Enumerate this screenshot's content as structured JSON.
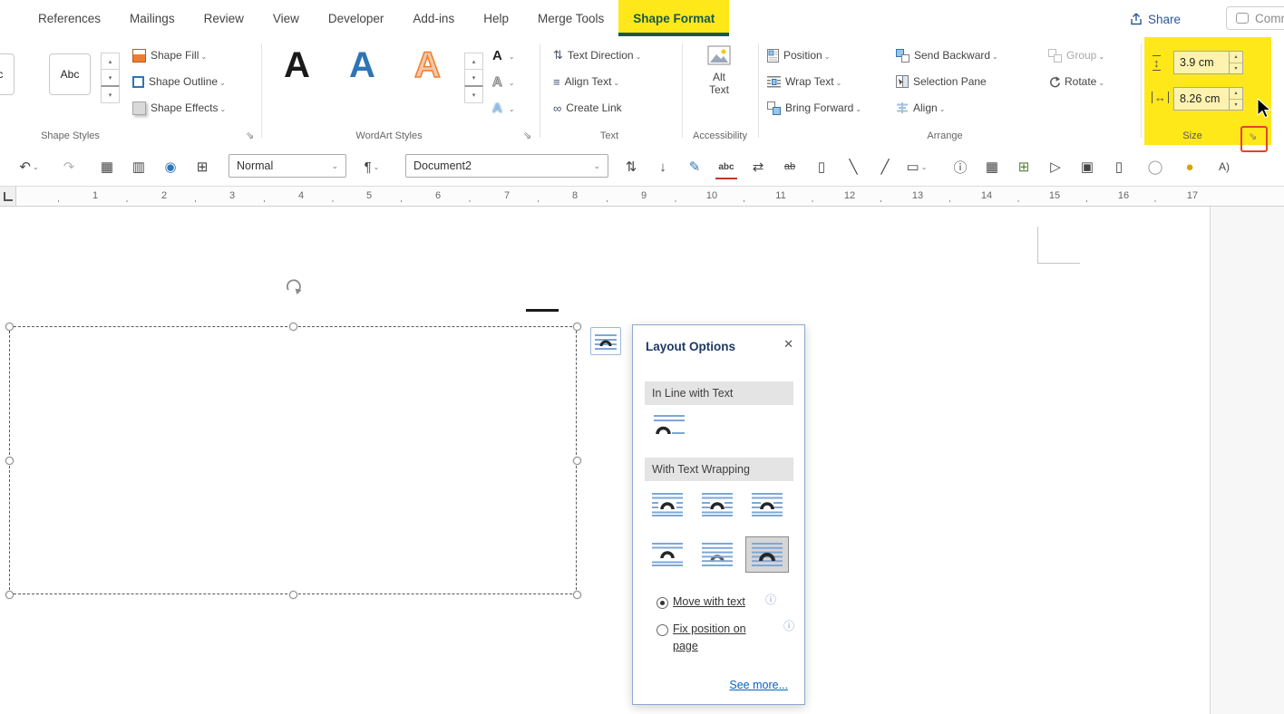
{
  "tabbar": {
    "tabs": [
      {
        "label": "References"
      },
      {
        "label": "Mailings"
      },
      {
        "label": "Review"
      },
      {
        "label": "View"
      },
      {
        "label": "Developer"
      },
      {
        "label": "Add-ins"
      },
      {
        "label": "Help"
      },
      {
        "label": "Merge Tools"
      },
      {
        "label": "Shape Format"
      }
    ],
    "share_label": "Share",
    "comments_label": "Comments"
  },
  "ribbon": {
    "shape_styles": {
      "label": "Shape Styles",
      "presets": [
        "Abc",
        "Abc"
      ],
      "fill_label": "Shape Fill",
      "outline_label": "Shape Outline",
      "effects_label": "Shape Effects"
    },
    "wordart": {
      "label": "WordArt Styles",
      "samples": [
        "A",
        "A",
        "A"
      ]
    },
    "text_group": {
      "label": "Text",
      "direction_label": "Text Direction",
      "align_label": "Align Text",
      "link_label": "Create Link"
    },
    "accessibility": {
      "label": "Accessibility",
      "alt_text_label": "Alt Text"
    },
    "arrange": {
      "label": "Arrange",
      "position_label": "Position",
      "wrap_label": "Wrap Text",
      "bring_forward_label": "Bring Forward",
      "send_backward_label": "Send Backward",
      "selection_pane_label": "Selection Pane",
      "align_label": "Align",
      "group_label": "Group",
      "rotate_label": "Rotate"
    },
    "size": {
      "label": "Size",
      "height_value": "3.9 cm",
      "width_value": "8.26 cm"
    }
  },
  "toolbar": {
    "style_value": "Normal",
    "document_value": "Document2",
    "icons": [
      {
        "name": "undo",
        "glyph": "↶"
      },
      {
        "name": "redo",
        "glyph": "↷"
      },
      {
        "name": "table-borders",
        "glyph": "▦"
      },
      {
        "name": "table-shading",
        "glyph": "▥"
      },
      {
        "name": "record-macro",
        "glyph": "◉"
      },
      {
        "name": "insert-table",
        "glyph": "⊞"
      },
      {
        "name": "pilcrow",
        "glyph": "¶"
      },
      {
        "name": "line-spacing",
        "glyph": "⇅"
      },
      {
        "name": "page-down",
        "glyph": "↓"
      },
      {
        "name": "edit-pen",
        "glyph": "✎"
      },
      {
        "name": "spell-check",
        "glyph": "abc"
      },
      {
        "name": "translate",
        "glyph": "⇄"
      },
      {
        "name": "strikethrough",
        "glyph": "ab"
      },
      {
        "name": "blank-page",
        "glyph": "▯"
      },
      {
        "name": "backslash",
        "glyph": "╲"
      },
      {
        "name": "slash",
        "glyph": "╱"
      },
      {
        "name": "text-frame",
        "glyph": "▭"
      },
      {
        "name": "doc-info",
        "glyph": "ⓘ"
      },
      {
        "name": "grid",
        "glyph": "▦"
      },
      {
        "name": "add-table",
        "glyph": "⊞"
      },
      {
        "name": "next-page",
        "glyph": "▷"
      },
      {
        "name": "print-layout",
        "glyph": "▣"
      },
      {
        "name": "page",
        "glyph": "▯"
      },
      {
        "name": "circle",
        "glyph": "◯"
      },
      {
        "name": "accent-circle",
        "glyph": "●"
      },
      {
        "name": "read-aloud",
        "glyph": "A)"
      }
    ]
  },
  "ruler": {
    "numbers": [
      "1",
      "2",
      "3",
      "4",
      "5",
      "6",
      "7",
      "8",
      "9",
      "10",
      "11",
      "12",
      "13",
      "14",
      "15",
      "16",
      "17"
    ]
  },
  "icons": {
    "gallery_up": "▴",
    "gallery_down": "▾",
    "gallery_more": "▾",
    "launcher": "⇘",
    "text_direction": "⇅",
    "align_text": "≡",
    "create_link": "∞",
    "height": "↕",
    "width": "↔",
    "spin_up": "▴",
    "spin_down": "▾",
    "close": "✕",
    "info": "ⓘ"
  },
  "panel": {
    "title": "Layout Options",
    "inline_header": "In Line with Text",
    "wrap_header": "With Text Wrapping",
    "move_with_text_label": "Move with text",
    "fix_position_label": "Fix position on page",
    "see_more_label": "See more..."
  },
  "colors": {
    "highlight_yellow": "#ffe819",
    "active_tab_text": "#17594a",
    "share_blue": "#2b579a",
    "callout_red": "#e8402f",
    "link_blue": "#0563c1",
    "wrap_line_blue": "#7da7d8"
  }
}
